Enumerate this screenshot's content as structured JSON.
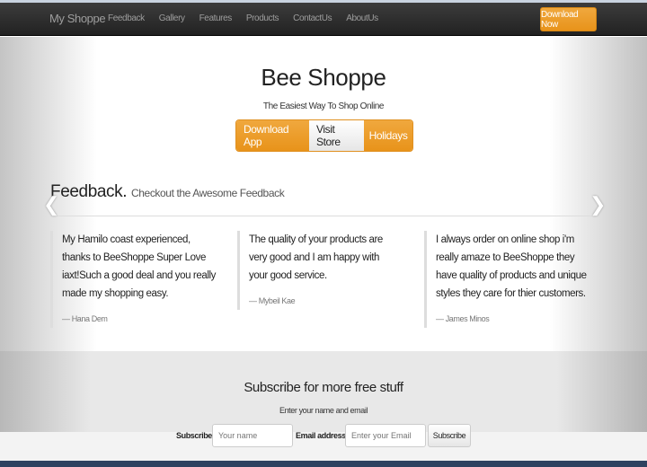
{
  "nav": {
    "brand": "My Shoppe",
    "links": [
      "Feedback",
      "Gallery",
      "Features",
      "Products",
      "ContactUs",
      "AboutUs"
    ],
    "cta": "Download Now"
  },
  "hero": {
    "title": "Bee Shoppe",
    "tagline": "The Easiest Way To Shop Online",
    "buttons": [
      "Download App",
      "Visit Store",
      "Holidays"
    ]
  },
  "feedback": {
    "heading": "Feedback.",
    "subheading": "Checkout the Awesome Feedback",
    "prev_icon": "chevron-left-icon",
    "next_icon": "chevron-right-icon",
    "quotes": [
      {
        "text": "My Hamilo coast experienced, thanks to BeeShoppe Super Love iaxt!Such a good deal and you really made my shopping easy.",
        "author": "— Hana Dem"
      },
      {
        "text": "The quality of your products are very good and I am happy with your good service.",
        "author": "— Mybeil Kae"
      },
      {
        "text": "I always order on online shop i'm really amaze to BeeShoppe they have quality of products and unique styles they care for thier customers.",
        "author": "— James Minos"
      }
    ]
  },
  "subscribe": {
    "title": "Subscribe for more free stuff",
    "description": "Enter your name and email",
    "name_label": "Subscribe",
    "name_placeholder": "Your name",
    "email_label": "Email address",
    "email_placeholder": "Enter your Email",
    "button": "Subscribe"
  },
  "colors": {
    "accent": "#eb9b2a",
    "navbar": "#2b2b2b"
  }
}
